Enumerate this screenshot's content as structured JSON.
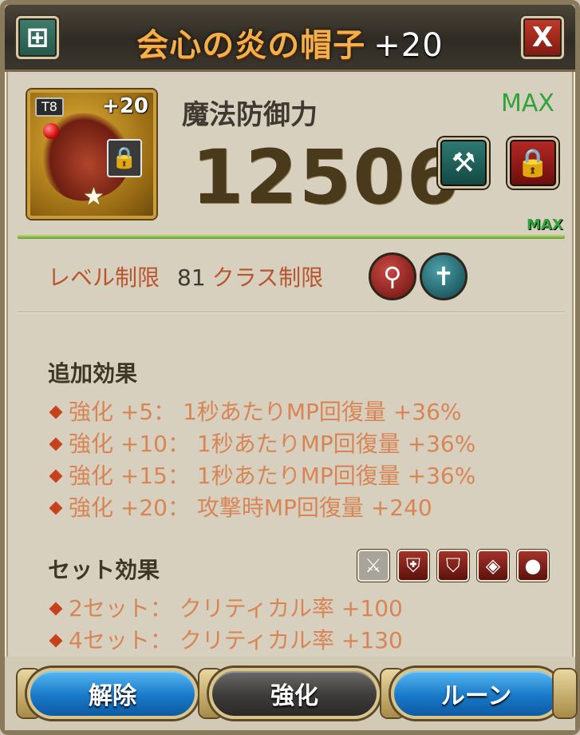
{
  "header": {
    "title": "会心の炎の帽子",
    "enhance_level": "+20",
    "add_icon": "plus-box-icon",
    "close_label": "X"
  },
  "item": {
    "tier": "T8",
    "level": "+20",
    "art_icon": "flame-hat-icon",
    "lock_icon": "padlock-icon",
    "star_icon": "star-icon"
  },
  "stat": {
    "name": "魔法防御力",
    "value": "12506",
    "max_label": "MAX",
    "max_small": "MAX",
    "progress": 1.0
  },
  "actions": {
    "anvil_icon": "anvil-hammer-icon",
    "lock_icon": "padlock-icon"
  },
  "requirements": {
    "level_label": "レベル制限",
    "level_value": "81",
    "class_label": "クラス制限",
    "class_icons": [
      "staff-class-icon",
      "cross-class-icon"
    ]
  },
  "additional_effects": {
    "title": "追加効果",
    "lines": [
      "強化 +5： 1秒あたりMP回復量 +36%",
      "強化 +10： 1秒あたりMP回復量 +36%",
      "強化 +15： 1秒あたりMP回復量 +36%",
      "強化 +20： 攻撃時MP回復量 +240"
    ]
  },
  "set_effects": {
    "title": "セット効果",
    "icons": [
      "sword-icon",
      "armor-icon",
      "robe-icon",
      "belt-icon",
      "orb-icon"
    ],
    "lines": [
      "2セット： クリティカル率 +100",
      "4セット： クリティカル率 +130"
    ]
  },
  "buttons": {
    "remove": "解除",
    "enhance": "強化",
    "rune": "ルーン"
  },
  "colors": {
    "title_gold": "#f3b04a",
    "effect_text": "#d88556",
    "max_green": "#2ea43a",
    "button_blue": "#1879c9"
  }
}
